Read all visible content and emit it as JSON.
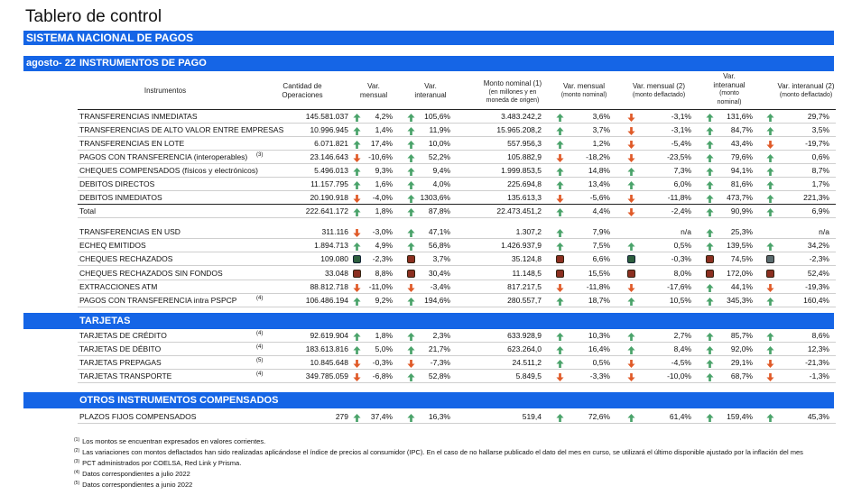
{
  "title": "Tablero de control",
  "sistema": "SISTEMA NACIONAL DE PAGOS",
  "period": "agosto- 22",
  "section_instrumentos": "INSTRUMENTOS DE PAGO",
  "headers": {
    "instrumentos": "Instrumentos",
    "cantidad": [
      "Cantidad de",
      "Operaciones"
    ],
    "var_mensual": [
      "Var.",
      "mensual"
    ],
    "var_interanual": [
      "Var.",
      "interanual"
    ],
    "monto": [
      "Monto nominal (1)",
      "(en millones y en",
      "moneda de origen)"
    ],
    "var_mensual_nom": [
      "Var. mensual",
      "(monto nominal)"
    ],
    "var_mensual_defl": [
      "Var. mensual (2)",
      "(monto deflactado)"
    ],
    "var_interanual_nom": [
      "Var.",
      "interanual",
      "(monto",
      "nominal)"
    ],
    "var_interanual_defl": [
      "Var. interanual (2)",
      "(monto deflactado)"
    ]
  },
  "rows_a": [
    {
      "name": "TRANSFERENCIAS INMEDIATAS",
      "note": "",
      "cant": "145.581.037",
      "i1": "up",
      "vm": "4,2%",
      "i2": "up",
      "vi": "105,6%",
      "monto": "3.483.242,2",
      "i3": "up",
      "vmn": "3,6%",
      "i4": "down",
      "vmd": "-3,1%",
      "i5": "up",
      "vin": "131,6%",
      "i6": "up",
      "vid": "29,7%"
    },
    {
      "name": "TRANSFERENCIAS DE ALTO VALOR ENTRE EMPRESAS",
      "note": "",
      "cant": "10.996.945",
      "i1": "up",
      "vm": "1,4%",
      "i2": "up",
      "vi": "11,9%",
      "monto": "15.965.208,2",
      "i3": "up",
      "vmn": "3,7%",
      "i4": "down",
      "vmd": "-3,1%",
      "i5": "up",
      "vin": "84,7%",
      "i6": "up",
      "vid": "3,5%"
    },
    {
      "name": "TRANSFERENCIAS EN LOTE",
      "note": "",
      "cant": "6.071.821",
      "i1": "up",
      "vm": "17,4%",
      "i2": "up",
      "vi": "10,0%",
      "monto": "557.956,3",
      "i3": "up",
      "vmn": "1,2%",
      "i4": "down",
      "vmd": "-5,4%",
      "i5": "up",
      "vin": "43,4%",
      "i6": "down",
      "vid": "-19,7%"
    },
    {
      "name": "PAGOS CON TRANSFERENCIA (interoperables)",
      "note": "(3)",
      "cant": "23.146.643",
      "i1": "down",
      "vm": "-10,6%",
      "i2": "up",
      "vi": "52,2%",
      "monto": "105.882,9",
      "i3": "down",
      "vmn": "-18,2%",
      "i4": "down",
      "vmd": "-23,5%",
      "i5": "up",
      "vin": "79,6%",
      "i6": "up",
      "vid": "0,6%"
    },
    {
      "name": "CHEQUES COMPENSADOS (físicos y electrónicos)",
      "note": "",
      "cant": "5.496.013",
      "i1": "up",
      "vm": "9,3%",
      "i2": "up",
      "vi": "9,4%",
      "monto": "1.999.853,5",
      "i3": "up",
      "vmn": "14,8%",
      "i4": "up",
      "vmd": "7,3%",
      "i5": "up",
      "vin": "94,1%",
      "i6": "up",
      "vid": "8,7%"
    },
    {
      "name": "DEBITOS DIRECTOS",
      "note": "",
      "cant": "11.157.795",
      "i1": "up",
      "vm": "1,6%",
      "i2": "up",
      "vi": "4,0%",
      "monto": "225.694,8",
      "i3": "up",
      "vmn": "13,4%",
      "i4": "up",
      "vmd": "6,0%",
      "i5": "up",
      "vin": "81,6%",
      "i6": "up",
      "vid": "1,7%"
    },
    {
      "name": "DEBITOS INMEDIATOS",
      "note": "",
      "cant": "20.190.918",
      "i1": "down",
      "vm": "-4,0%",
      "i2": "up",
      "vi": "1303,6%",
      "monto": "135.613,3",
      "i3": "down",
      "vmn": "-5,6%",
      "i4": "down",
      "vmd": "-11,8%",
      "i5": "up",
      "vin": "473,7%",
      "i6": "up",
      "vid": "221,3%"
    },
    {
      "name": "Total",
      "note": "",
      "cant": "222.641.172",
      "i1": "up",
      "vm": "1,8%",
      "i2": "up",
      "vi": "87,8%",
      "monto": "22.473.451,2",
      "i3": "up",
      "vmn": "4,4%",
      "i4": "down",
      "vmd": "-2,4%",
      "i5": "up",
      "vin": "90,9%",
      "i6": "up",
      "vid": "6,9%"
    }
  ],
  "rows_b": [
    {
      "name": "TRANSFERENCIAS EN USD",
      "note": "",
      "cant": "311.116",
      "i1": "down",
      "vm": "-3,0%",
      "i2": "up",
      "vi": "47,1%",
      "monto": "1.307,2",
      "i3": "up",
      "vmn": "7,9%",
      "i4": "",
      "vmd": "n/a",
      "i5": "up",
      "vin": "25,3%",
      "i6": "",
      "vid": "n/a"
    },
    {
      "name": "ECHEQ EMITIDOS",
      "note": "",
      "cant": "1.894.713",
      "i1": "up",
      "vm": "4,9%",
      "i2": "up",
      "vi": "56,8%",
      "monto": "1.426.937,9",
      "i3": "up",
      "vmn": "7,5%",
      "i4": "up",
      "vmd": "0,5%",
      "i5": "up",
      "vin": "139,5%",
      "i6": "up",
      "vid": "34,2%"
    },
    {
      "name": "CHEQUES RECHAZADOS",
      "note": "",
      "cant": "109.080",
      "i1": "green",
      "vm": "-2,3%",
      "i2": "red",
      "vi": "3,7%",
      "monto": "35.124,8",
      "i3": "red",
      "vmn": "6,6%",
      "i4": "green",
      "vmd": "-0,3%",
      "i5": "red",
      "vin": "74,5%",
      "i6": "gray",
      "vid": "-2,3%"
    },
    {
      "name": "CHEQUES RECHAZADOS SIN FONDOS",
      "note": "",
      "cant": "33.048",
      "i1": "red",
      "vm": "8,8%",
      "i2": "red",
      "vi": "30,4%",
      "monto": "11.148,5",
      "i3": "red",
      "vmn": "15,5%",
      "i4": "red",
      "vmd": "8,0%",
      "i5": "red",
      "vin": "172,0%",
      "i6": "red",
      "vid": "52,4%"
    },
    {
      "name": "EXTRACCIONES ATM",
      "note": "",
      "cant": "88.812.718",
      "i1": "down",
      "vm": "-11,0%",
      "i2": "down",
      "vi": "-3,4%",
      "monto": "817.217,5",
      "i3": "down",
      "vmn": "-11,8%",
      "i4": "down",
      "vmd": "-17,6%",
      "i5": "up",
      "vin": "44,1%",
      "i6": "down",
      "vid": "-19,3%"
    },
    {
      "name": "PAGOS CON TRANSFERENCIA intra PSPCP",
      "note": "(4)",
      "cant": "106.486.194",
      "i1": "up",
      "vm": "9,2%",
      "i2": "up",
      "vi": "194,6%",
      "monto": "280.557,7",
      "i3": "up",
      "vmn": "18,7%",
      "i4": "up",
      "vmd": "10,5%",
      "i5": "up",
      "vin": "345,3%",
      "i6": "up",
      "vid": "160,4%"
    }
  ],
  "section_tarjetas": "TARJETAS",
  "rows_c": [
    {
      "name": "TARJETAS DE CRÉDITO",
      "note": "(4)",
      "cant": "92.619.904",
      "i1": "up",
      "vm": "1,8%",
      "i2": "up",
      "vi": "2,3%",
      "monto": "633.928,9",
      "i3": "up",
      "vmn": "10,3%",
      "i4": "up",
      "vmd": "2,7%",
      "i5": "up",
      "vin": "85,7%",
      "i6": "up",
      "vid": "8,6%"
    },
    {
      "name": "TARJETAS DE DÉBITO",
      "note": "(4)",
      "cant": "183.613.816",
      "i1": "up",
      "vm": "5,0%",
      "i2": "up",
      "vi": "21,7%",
      "monto": "623.264,0",
      "i3": "up",
      "vmn": "16,4%",
      "i4": "up",
      "vmd": "8,4%",
      "i5": "up",
      "vin": "92,0%",
      "i6": "up",
      "vid": "12,3%"
    },
    {
      "name": "TARJETAS PREPAGAS",
      "note": "(5)",
      "cant": "10.845.648",
      "i1": "down",
      "vm": "-0,3%",
      "i2": "down",
      "vi": "-7,3%",
      "monto": "24.511,2",
      "i3": "up",
      "vmn": "0,5%",
      "i4": "down",
      "vmd": "-4,5%",
      "i5": "up",
      "vin": "29,1%",
      "i6": "down",
      "vid": "-21,3%"
    },
    {
      "name": "TARJETAS TRANSPORTE",
      "note": "(4)",
      "cant": "349.785.059",
      "i1": "down",
      "vm": "-6,8%",
      "i2": "up",
      "vi": "52,8%",
      "monto": "5.849,5",
      "i3": "down",
      "vmn": "-3,3%",
      "i4": "down",
      "vmd": "-10,0%",
      "i5": "up",
      "vin": "68,7%",
      "i6": "down",
      "vid": "-1,3%"
    }
  ],
  "section_otros": "OTROS INSTRUMENTOS COMPENSADOS",
  "rows_d": [
    {
      "name": "PLAZOS FIJOS COMPENSADOS",
      "note": "",
      "cant": "279",
      "i1": "up",
      "vm": "37,4%",
      "i2": "up",
      "vi": "16,3%",
      "monto": "519,4",
      "i3": "up",
      "vmn": "72,6%",
      "i4": "up",
      "vmd": "61,4%",
      "i5": "up",
      "vin": "159,4%",
      "i6": "up",
      "vid": "45,3%"
    }
  ],
  "footnotes": [
    {
      "n": "(1)",
      "text": "Los montos se encuentran expresados en valores corrientes."
    },
    {
      "n": "(2)",
      "text": "Las variaciones con montos deflactados han sido realizadas aplicándose el índice de precios al consumidor (IPC). En el caso de no hallarse publicado el dato del mes en curso, se utilizará el último disponible ajustado por la inflación del mes"
    },
    {
      "n": "(3)",
      "text": "PCT administrados por COELSA, Red Link y Prisma."
    },
    {
      "n": "(4)",
      "text": "Datos correspondientes a julio 2022"
    },
    {
      "n": "(5)",
      "text": "Datos correspondientes a junio 2022"
    }
  ],
  "colors": {
    "accent": "#1565e6",
    "up": "#4aa36a",
    "down": "#e05a28"
  }
}
